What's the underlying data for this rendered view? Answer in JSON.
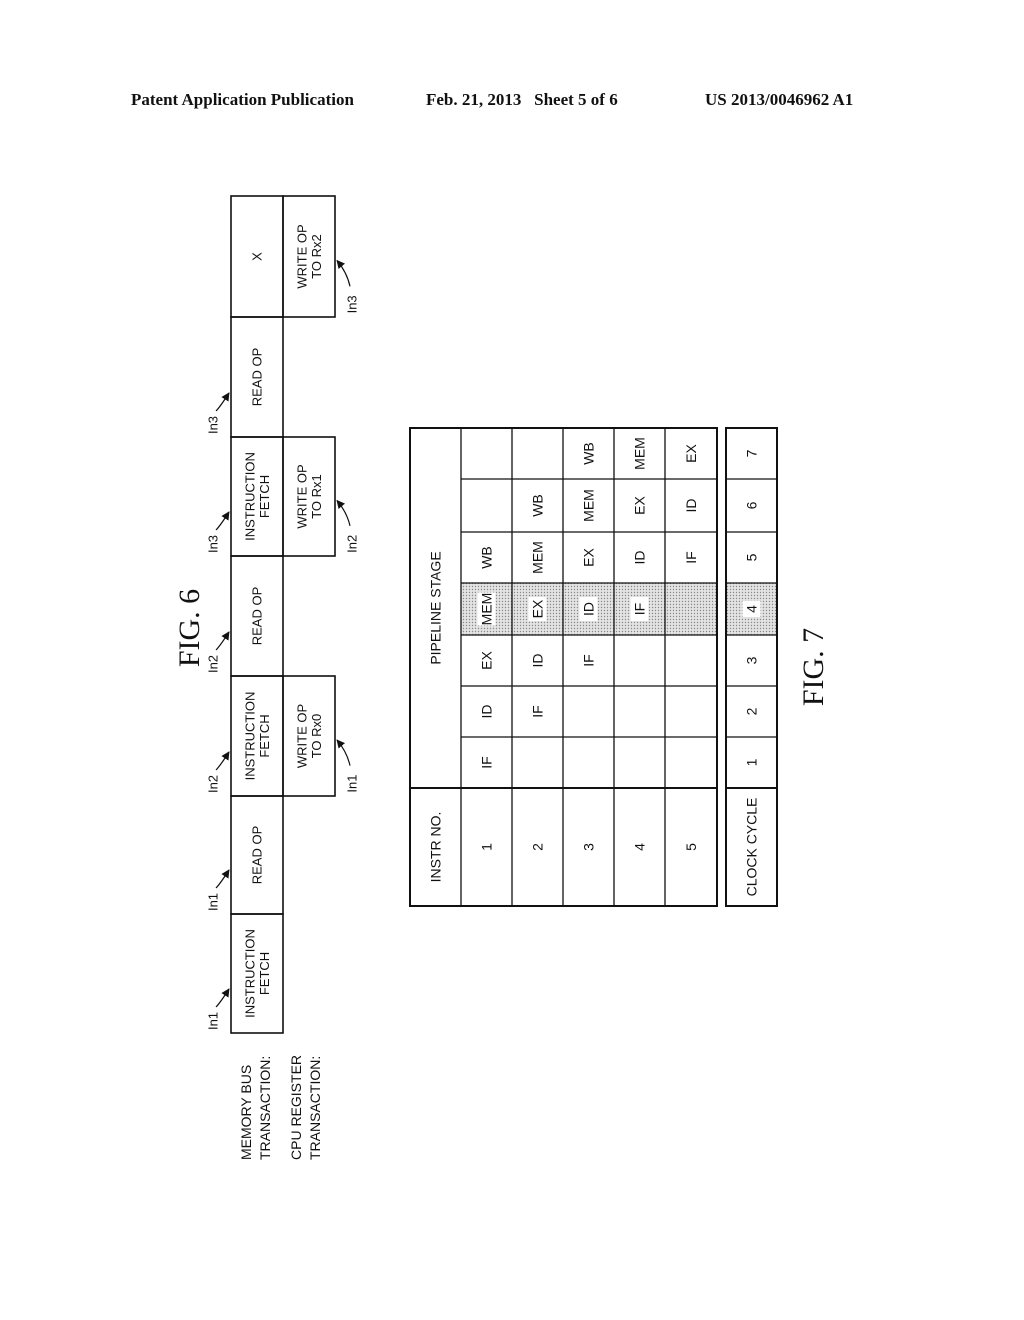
{
  "header": {
    "publication": "Patent Application Publication",
    "date_sheet": "Feb. 21, 2013   Sheet 5 of 6",
    "number": "US 2013/0046962 A1"
  },
  "fig6": {
    "title": "FIG. 6",
    "row_labels": {
      "memory_bus": [
        "MEMORY BUS",
        "TRANSACTION:"
      ],
      "cpu_register": [
        "CPU REGISTER",
        "TRANSACTION:"
      ]
    },
    "memory_cells": [
      {
        "lines": [
          "INSTRUCTION",
          "FETCH"
        ],
        "callout": "In1"
      },
      {
        "lines": [
          "READ OP"
        ],
        "callout": "In1"
      },
      {
        "lines": [
          "INSTRUCTION",
          "FETCH"
        ],
        "callout": "In2"
      },
      {
        "lines": [
          "READ OP"
        ],
        "callout": "In2"
      },
      {
        "lines": [
          "INSTRUCTION",
          "FETCH"
        ],
        "callout": "In3"
      },
      {
        "lines": [
          "READ OP"
        ],
        "callout": "In3"
      },
      {
        "lines": [
          "X"
        ],
        "callout": ""
      }
    ],
    "cpu_cells": [
      {
        "slot": 2,
        "lines": [
          "WRITE OP",
          "TO Rx0"
        ],
        "callout": "In1"
      },
      {
        "slot": 4,
        "lines": [
          "WRITE OP",
          "TO Rx1"
        ],
        "callout": "In2"
      },
      {
        "slot": 6,
        "lines": [
          "WRITE OP",
          "TO Rx2"
        ],
        "callout": "In3"
      }
    ]
  },
  "fig7": {
    "title": "FIG. 7",
    "instr_header": "INSTR NO.",
    "stage_header": "PIPELINE STAGE",
    "clock_header": "CLOCK CYCLE",
    "rows": [
      {
        "instr": "1",
        "stages": [
          "IF",
          "ID",
          "EX",
          "MEM",
          "WB",
          "",
          ""
        ]
      },
      {
        "instr": "2",
        "stages": [
          "",
          "IF",
          "ID",
          "EX",
          "MEM",
          "WB",
          ""
        ]
      },
      {
        "instr": "3",
        "stages": [
          "",
          "",
          "IF",
          "ID",
          "EX",
          "MEM",
          "WB"
        ]
      },
      {
        "instr": "4",
        "stages": [
          "",
          "",
          "",
          "IF",
          "ID",
          "EX",
          "MEM"
        ]
      },
      {
        "instr": "5",
        "stages": [
          "",
          "",
          "",
          "",
          "IF",
          "ID",
          "EX"
        ]
      }
    ],
    "clock_cycles": [
      "1",
      "2",
      "3",
      "4",
      "5",
      "6",
      "7"
    ],
    "highlighted_cycle": "4"
  }
}
